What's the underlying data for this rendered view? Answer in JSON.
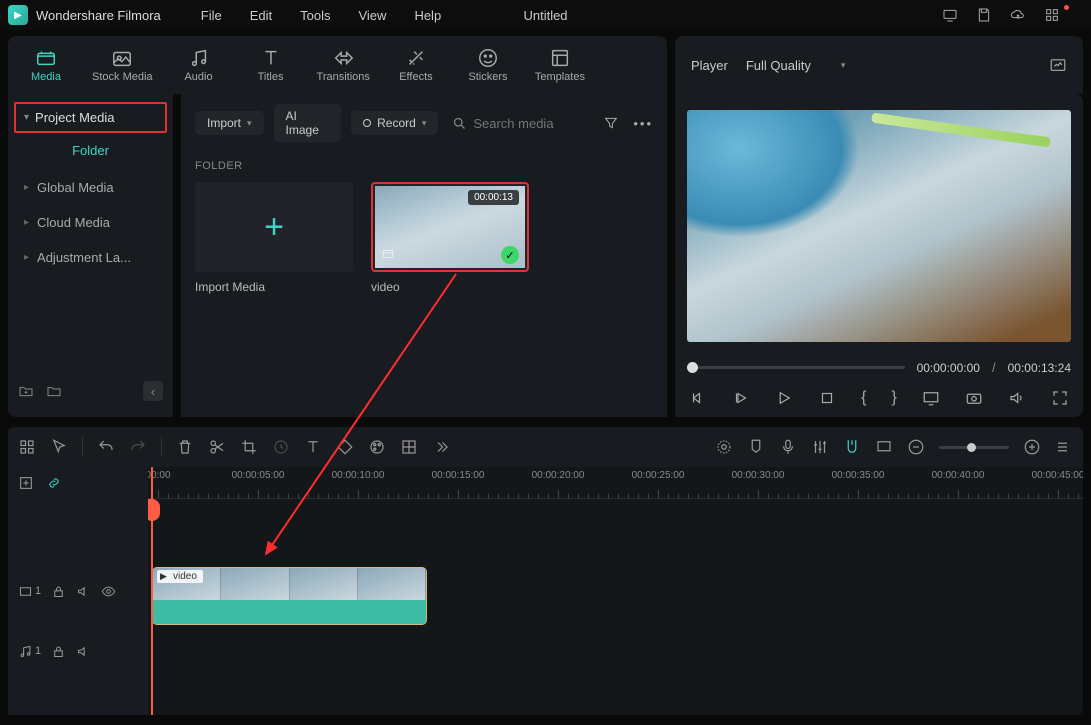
{
  "app": {
    "name": "Wondershare Filmora",
    "document": "Untitled"
  },
  "menu": {
    "file": "File",
    "edit": "Edit",
    "tools": "Tools",
    "view": "View",
    "help": "Help"
  },
  "tabs": {
    "media": "Media",
    "stock": "Stock Media",
    "audio": "Audio",
    "titles": "Titles",
    "transitions": "Transitions",
    "effects": "Effects",
    "stickers": "Stickers",
    "templates": "Templates"
  },
  "sidebar": {
    "project_media": "Project Media",
    "folder": "Folder",
    "global": "Global Media",
    "cloud": "Cloud Media",
    "adjustment": "Adjustment La..."
  },
  "center": {
    "import": "Import",
    "ai_image": "AI Image",
    "record": "Record",
    "search_placeholder": "Search media",
    "section": "FOLDER",
    "import_tile": "Import Media",
    "video_tile": "video",
    "video_duration": "00:00:13"
  },
  "player": {
    "label": "Player",
    "quality": "Full Quality",
    "current": "00:00:00:00",
    "total": "00:00:13:24"
  },
  "timeline": {
    "marks": [
      "00:00",
      "00:00:05:00",
      "00:00:10:00",
      "00:00:15:00",
      "00:00:20:00",
      "00:00:25:00",
      "00:00:30:00",
      "00:00:35:00",
      "00:00:40:00",
      "00:00:45:00"
    ],
    "clip_label": "video",
    "video_track": "1",
    "audio_track": "1"
  }
}
